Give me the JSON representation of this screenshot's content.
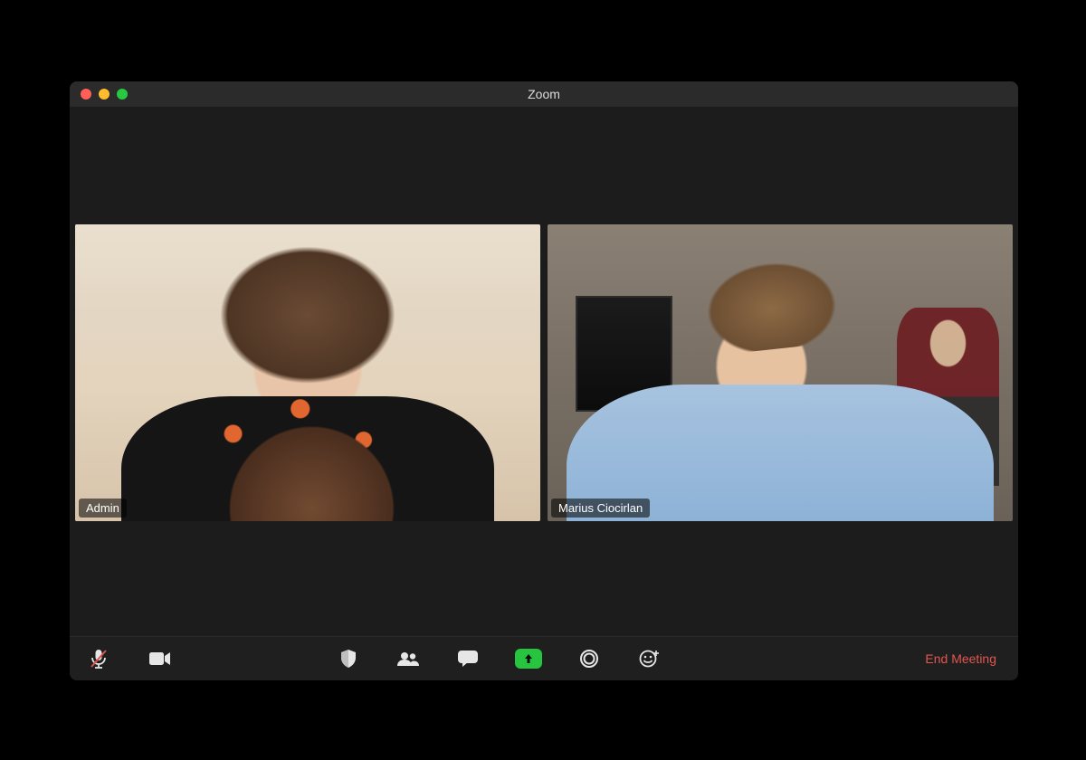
{
  "window": {
    "title": "Zoom"
  },
  "participants": [
    {
      "name": "Admin",
      "active_speaker": true
    },
    {
      "name": "Marius Ciocirlan",
      "active_speaker": false
    }
  ],
  "toolbar": {
    "mute_icon": "microphone-muted-icon",
    "video_icon": "video-icon",
    "security_icon": "shield-icon",
    "participants_icon": "people-icon",
    "chat_icon": "chat-icon",
    "share_icon": "share-screen-icon",
    "record_icon": "record-icon",
    "reactions_icon": "smiley-plus-icon",
    "end_label": "End Meeting"
  },
  "colors": {
    "active_border": "#a4e24a",
    "share_bg": "#27c43f",
    "end_text": "#e25650",
    "window_bg": "#1c1c1c",
    "titlebar_bg": "#2b2b2b"
  }
}
